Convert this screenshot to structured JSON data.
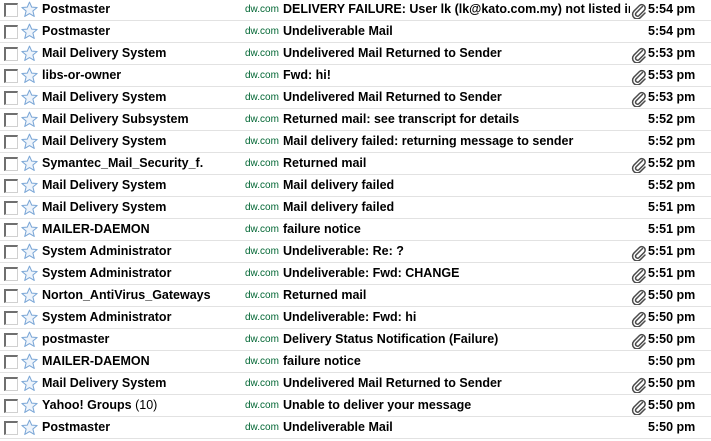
{
  "messages": [
    {
      "sender": "Postmaster",
      "count": "",
      "label": "dw.com",
      "subject": "DELIVERY FAILURE: User lk (lk@kato.com.my) not listed in public Name & Address Book",
      "attachment": true,
      "time": "5:54 pm"
    },
    {
      "sender": "Postmaster",
      "count": "",
      "label": "dw.com",
      "subject": "Undeliverable Mail",
      "attachment": false,
      "time": "5:54 pm"
    },
    {
      "sender": "Mail Delivery System",
      "count": "",
      "label": "dw.com",
      "subject": "Undelivered Mail Returned to Sender",
      "attachment": true,
      "time": "5:53 pm"
    },
    {
      "sender": "libs-or-owner",
      "count": "",
      "label": "dw.com",
      "subject": "Fwd: hi!",
      "attachment": true,
      "time": "5:53 pm"
    },
    {
      "sender": "Mail Delivery System",
      "count": "",
      "label": "dw.com",
      "subject": "Undelivered Mail Returned to Sender",
      "attachment": true,
      "time": "5:53 pm"
    },
    {
      "sender": "Mail Delivery Subsystem",
      "count": "",
      "label": "dw.com",
      "subject": "Returned mail: see transcript for details",
      "attachment": false,
      "time": "5:52 pm"
    },
    {
      "sender": "Mail Delivery System",
      "count": "",
      "label": "dw.com",
      "subject": "Mail delivery failed: returning message to sender",
      "attachment": false,
      "time": "5:52 pm"
    },
    {
      "sender": "Symantec_Mail_Security_f.",
      "count": "",
      "label": "dw.com",
      "subject": "Returned mail",
      "attachment": true,
      "time": "5:52 pm"
    },
    {
      "sender": "Mail Delivery System",
      "count": "",
      "label": "dw.com",
      "subject": "Mail delivery failed",
      "attachment": false,
      "time": "5:52 pm"
    },
    {
      "sender": "Mail Delivery System",
      "count": "",
      "label": "dw.com",
      "subject": "Mail delivery failed",
      "attachment": false,
      "time": "5:51 pm"
    },
    {
      "sender": "MAILER-DAEMON",
      "count": "",
      "label": "dw.com",
      "subject": "failure notice",
      "attachment": false,
      "time": "5:51 pm"
    },
    {
      "sender": "System Administrator",
      "count": "",
      "label": "dw.com",
      "subject": "Undeliverable: Re: ?",
      "attachment": true,
      "time": "5:51 pm"
    },
    {
      "sender": "System Administrator",
      "count": "",
      "label": "dw.com",
      "subject": "Undeliverable: Fwd: CHANGE",
      "attachment": true,
      "time": "5:51 pm"
    },
    {
      "sender": "Norton_AntiVirus_Gateways",
      "count": "",
      "label": "dw.com",
      "subject": "Returned mail",
      "attachment": true,
      "time": "5:50 pm"
    },
    {
      "sender": "System Administrator",
      "count": "",
      "label": "dw.com",
      "subject": "Undeliverable: Fwd: hi",
      "attachment": true,
      "time": "5:50 pm"
    },
    {
      "sender": "postmaster",
      "count": "",
      "label": "dw.com",
      "subject": "Delivery Status Notification (Failure)",
      "attachment": true,
      "time": "5:50 pm"
    },
    {
      "sender": "MAILER-DAEMON",
      "count": "",
      "label": "dw.com",
      "subject": "failure notice",
      "attachment": false,
      "time": "5:50 pm"
    },
    {
      "sender": "Mail Delivery System",
      "count": "",
      "label": "dw.com",
      "subject": "Undelivered Mail Returned to Sender",
      "attachment": true,
      "time": "5:50 pm"
    },
    {
      "sender": "Yahoo! Groups",
      "count": "(10)",
      "label": "dw.com",
      "subject": "Unable to deliver your message",
      "attachment": true,
      "time": "5:50 pm"
    },
    {
      "sender": "Postmaster",
      "count": "",
      "label": "dw.com",
      "subject": "Undeliverable Mail",
      "attachment": false,
      "time": "5:50 pm"
    }
  ],
  "colors": {
    "label_green": "#006633",
    "row_divider": "#e2e2e2",
    "star_outline": "#7aa6d6",
    "star_fill": "#eef4fb"
  },
  "icons": {
    "star": "star-icon",
    "attachment": "paperclip-icon",
    "checkbox": "checkbox"
  }
}
